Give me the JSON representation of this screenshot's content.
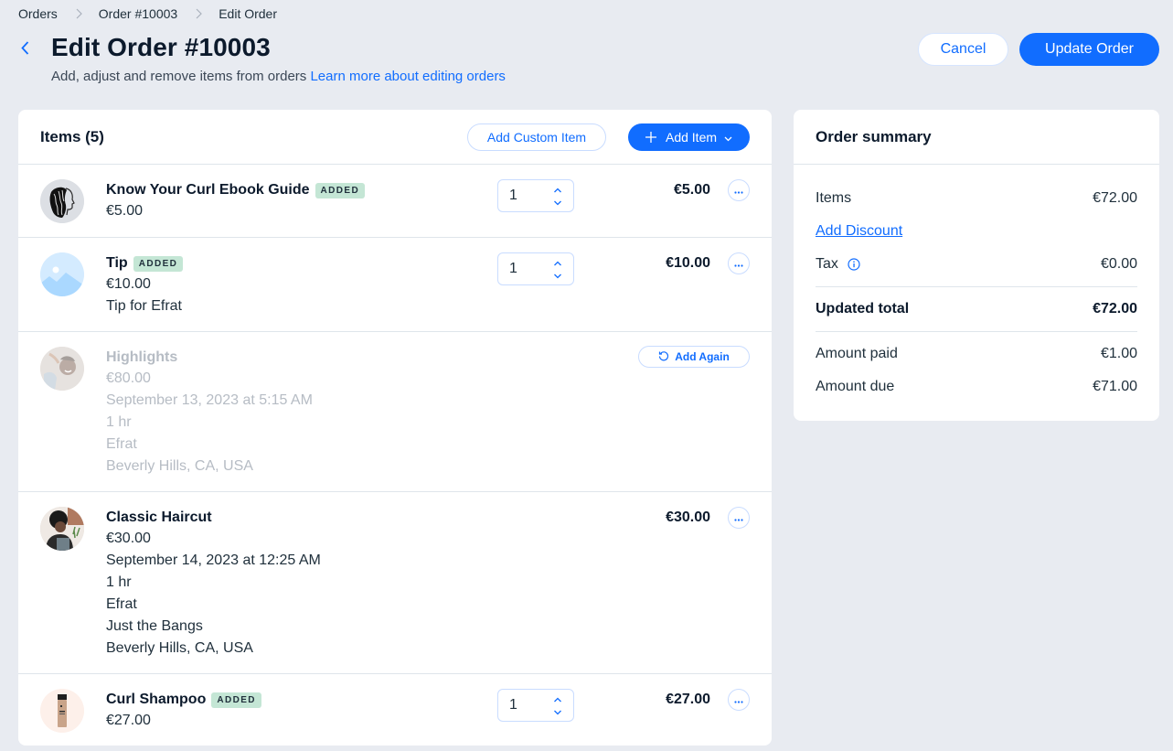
{
  "breadcrumb": [
    "Orders",
    "Order #10003",
    "Edit Order"
  ],
  "header": {
    "title": "Edit Order #10003",
    "subtitle": "Add, adjust and remove items from orders",
    "learn_more": "Learn more about editing orders",
    "cancel": "Cancel",
    "update": "Update Order"
  },
  "items_card": {
    "title": "Items (5)",
    "add_custom": "Add Custom Item",
    "add_item": "Add Item",
    "add_again": "Add Again",
    "items": [
      {
        "name": "Know Your Curl Ebook Guide",
        "badge": "ADDED",
        "lines": [
          "€5.00"
        ],
        "qty": "1",
        "price": "€5.00",
        "thumb": "curl-ebook-thumbnail"
      },
      {
        "name": "Tip",
        "badge": "ADDED",
        "lines": [
          "€10.00",
          "Tip for Efrat"
        ],
        "qty": "1",
        "price": "€10.00",
        "thumb": "image-placeholder"
      },
      {
        "name": "Highlights",
        "badge": null,
        "lines": [
          "€80.00",
          "September 13, 2023 at 5:15 AM",
          "1 hr",
          "Efrat",
          "Beverly Hills, CA, USA"
        ],
        "removed": true,
        "thumb": "highlights-photo"
      },
      {
        "name": "Classic Haircut",
        "badge": null,
        "lines": [
          "€30.00",
          "September 14, 2023 at 12:25 AM",
          "1 hr",
          "Efrat",
          "Just the Bangs",
          "Beverly Hills, CA, USA"
        ],
        "price": "€30.00",
        "thumb": "haircut-photo"
      },
      {
        "name": "Curl Shampoo",
        "badge": "ADDED",
        "lines": [
          "€27.00"
        ],
        "qty": "1",
        "price": "€27.00",
        "thumb": "shampoo-photo"
      }
    ]
  },
  "summary": {
    "title": "Order summary",
    "items_label": "Items",
    "items_value": "€72.00",
    "add_discount": "Add Discount",
    "tax_label": "Tax",
    "tax_value": "€0.00",
    "total_label": "Updated total",
    "total_value": "€72.00",
    "paid_label": "Amount paid",
    "paid_value": "€1.00",
    "due_label": "Amount due",
    "due_value": "€71.00"
  },
  "colors": {
    "accent": "#116dff",
    "badge_bg": "#c4e6d5",
    "background": "#e8ebf1"
  }
}
